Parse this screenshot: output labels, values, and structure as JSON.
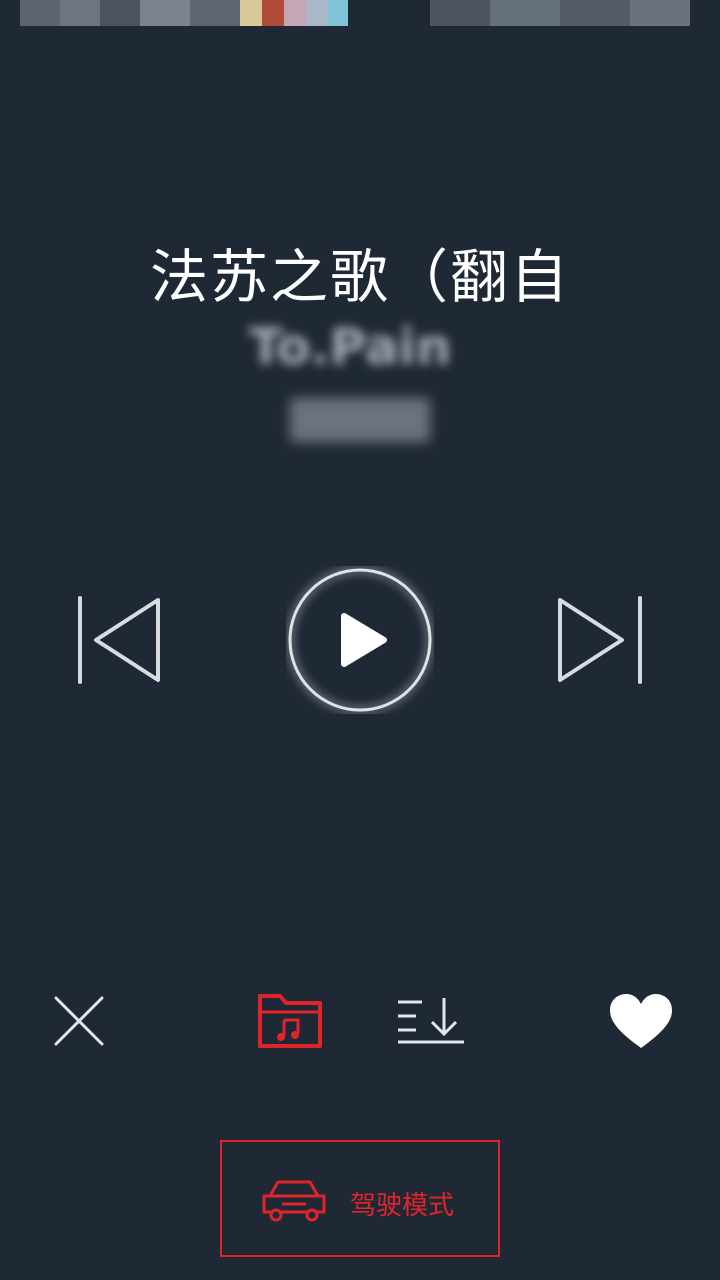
{
  "song": {
    "title": "法苏之歌（翻自",
    "subtitle": "To.Pain",
    "artist": ""
  },
  "player": {
    "state": "paused"
  },
  "drive_mode": {
    "label": "驾驶模式"
  },
  "colors": {
    "background": "#1f2835",
    "accent": "#e0242a",
    "icon": "#d8dce1"
  },
  "icons": {
    "previous": "skip-previous-icon",
    "play": "play-icon",
    "next": "skip-next-icon",
    "close": "close-icon",
    "music_folder": "music-folder-icon",
    "sort": "sort-download-icon",
    "favorite": "heart-icon",
    "car": "car-icon"
  }
}
